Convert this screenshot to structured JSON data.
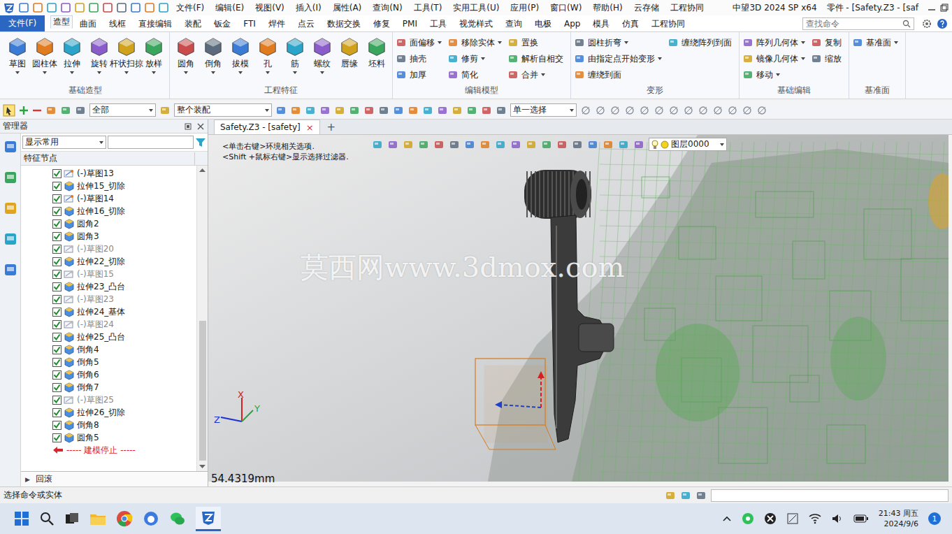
{
  "window": {
    "app": "中望3D 2024 SP x64",
    "title": "零件 - [Safety.Z3 - [saf"
  },
  "menu": [
    "文件(F)",
    "编辑(E)",
    "视图(V)",
    "插入(I)",
    "属性(A)",
    "查询(N)",
    "工具(T)",
    "实用工具(U)",
    "应用(P)",
    "窗口(W)",
    "帮助(H)",
    "云存储",
    "工程协同"
  ],
  "ribbon_tabs": {
    "file_button": "文件(F)",
    "tabs": [
      {
        "label": "造型",
        "selected": true
      },
      {
        "label": "曲面",
        "selected": false
      },
      {
        "label": "线框",
        "selected": false
      },
      {
        "label": "直接编辑",
        "selected": false
      },
      {
        "label": "装配",
        "selected": false
      },
      {
        "label": "钣金",
        "selected": false
      },
      {
        "label": "FTI",
        "selected": false
      },
      {
        "label": "焊件",
        "selected": false
      },
      {
        "label": "点云",
        "selected": false
      },
      {
        "label": "数据交换",
        "selected": false
      },
      {
        "label": "修复",
        "selected": false
      },
      {
        "label": "PMI",
        "selected": false
      },
      {
        "label": "工具",
        "selected": false
      },
      {
        "label": "视觉样式",
        "selected": false
      },
      {
        "label": "查询",
        "selected": false
      },
      {
        "label": "电极",
        "selected": false
      },
      {
        "label": "App",
        "selected": false
      },
      {
        "label": "模具",
        "selected": false
      },
      {
        "label": "仿真",
        "selected": false
      },
      {
        "label": "工程协同",
        "selected": false
      }
    ],
    "search": {
      "placeholder": "查找命令"
    }
  },
  "ribbon_groups": [
    {
      "title": "基础造型",
      "kind": "large",
      "buttons": [
        {
          "label": "草图",
          "dropdown": true
        },
        {
          "label": "圆柱体",
          "dropdown": true
        },
        {
          "label": "拉伸",
          "dropdown": true
        },
        {
          "label": "旋转",
          "dropdown": true
        },
        {
          "label": "杆状扫掠",
          "dropdown": true
        },
        {
          "label": "放样",
          "dropdown": true
        }
      ]
    },
    {
      "title": "工程特征",
      "kind": "large",
      "buttons": [
        {
          "label": "圆角",
          "dropdown": true
        },
        {
          "label": "倒角",
          "dropdown": true
        },
        {
          "label": "拔模",
          "dropdown": true
        },
        {
          "label": "孔",
          "dropdown": true
        },
        {
          "label": "筋",
          "dropdown": true
        },
        {
          "label": "螺纹",
          "dropdown": true
        },
        {
          "label": "唇缘",
          "dropdown": false
        },
        {
          "label": "坯料",
          "dropdown": false
        }
      ]
    },
    {
      "title": "编辑模型",
      "kind": "small",
      "columns": [
        [
          {
            "label": "面偏移",
            "dropdown": true
          },
          {
            "label": "抽壳",
            "dropdown": false
          },
          {
            "label": "加厚",
            "dropdown": false
          }
        ],
        [
          {
            "label": "移除实体",
            "dropdown": true
          },
          {
            "label": "修剪",
            "dropdown": true
          },
          {
            "label": "简化",
            "dropdown": false
          }
        ],
        [
          {
            "label": "置换",
            "dropdown": false
          },
          {
            "label": "解析自相交",
            "dropdown": false
          },
          {
            "label": "合并",
            "dropdown": true
          }
        ]
      ]
    },
    {
      "title": "变形",
      "kind": "small",
      "columns": [
        [
          {
            "label": "圆柱折弯",
            "dropdown": true
          },
          {
            "label": "由指定点开始变形",
            "dropdown": true
          },
          {
            "label": "缠绕到面",
            "dropdown": false
          }
        ],
        [
          {
            "label": "缠绕阵列到面",
            "dropdown": false
          }
        ]
      ]
    },
    {
      "title": "基础编辑",
      "kind": "small",
      "columns": [
        [
          {
            "label": "阵列几何体",
            "dropdown": true
          },
          {
            "label": "镜像几何体",
            "dropdown": true
          },
          {
            "label": "移动",
            "dropdown": true
          }
        ],
        [
          {
            "label": "复制",
            "dropdown": false
          },
          {
            "label": "缩放",
            "dropdown": false
          }
        ]
      ]
    },
    {
      "title": "基准面",
      "kind": "small",
      "columns": [
        [
          {
            "label": "基准面",
            "dropdown": true
          }
        ]
      ]
    }
  ],
  "toolbar": {
    "filter": "全部",
    "scope": "整个装配",
    "select_mode": "单一选择"
  },
  "manager": {
    "title": "管理器",
    "filter": "显示常用",
    "header": "特征节点",
    "items": [
      {
        "label": "(-)草图13",
        "kind": "sketch",
        "checked": true,
        "disabled": false
      },
      {
        "label": "拉伸15_切除",
        "kind": "feature",
        "checked": true,
        "disabled": false
      },
      {
        "label": "(-)草图14",
        "kind": "sketch",
        "checked": true,
        "disabled": false
      },
      {
        "label": "拉伸16_切除",
        "kind": "feature",
        "checked": true,
        "disabled": false
      },
      {
        "label": "圆角2",
        "kind": "feature",
        "checked": true,
        "disabled": false
      },
      {
        "label": "圆角3",
        "kind": "feature",
        "checked": true,
        "disabled": false
      },
      {
        "label": "(-)草图20",
        "kind": "sketch",
        "checked": true,
        "disabled": true
      },
      {
        "label": "拉伸22_切除",
        "kind": "feature",
        "checked": true,
        "disabled": false
      },
      {
        "label": "(-)草图15",
        "kind": "sketch",
        "checked": true,
        "disabled": true
      },
      {
        "label": "拉伸23_凸台",
        "kind": "feature",
        "checked": true,
        "disabled": false
      },
      {
        "label": "(-)草图23",
        "kind": "sketch",
        "checked": true,
        "disabled": true
      },
      {
        "label": "拉伸24_基体",
        "kind": "feature",
        "checked": true,
        "disabled": false
      },
      {
        "label": "(-)草图24",
        "kind": "sketch",
        "checked": true,
        "disabled": true
      },
      {
        "label": "拉伸25_凸台",
        "kind": "feature",
        "checked": true,
        "disabled": false
      },
      {
        "label": "倒角4",
        "kind": "feature",
        "checked": true,
        "disabled": false
      },
      {
        "label": "倒角5",
        "kind": "feature",
        "checked": true,
        "disabled": false
      },
      {
        "label": "倒角6",
        "kind": "feature",
        "checked": true,
        "disabled": false
      },
      {
        "label": "倒角7",
        "kind": "feature",
        "checked": true,
        "disabled": false
      },
      {
        "label": "(-)草图25",
        "kind": "sketch",
        "checked": true,
        "disabled": true
      },
      {
        "label": "拉伸26_切除",
        "kind": "feature",
        "checked": true,
        "disabled": false
      },
      {
        "label": "倒角8",
        "kind": "feature",
        "checked": true,
        "disabled": false
      },
      {
        "label": "圆角5",
        "kind": "feature",
        "checked": true,
        "disabled": false
      }
    ],
    "stop_marker": "----- 建模停止 -----",
    "rollback_toggle": "▶",
    "rollback": "回滚"
  },
  "viewport": {
    "tab": "Safety.Z3 - [safety]",
    "tab_close": "×",
    "tab_add": "+",
    "hints": [
      "<单击右键>环境相关选项.",
      "<Shift +鼠标右键>显示选择过滤器."
    ],
    "layer": "图层0000",
    "watermark": "莫西网www.3dmox.com",
    "measure": "54.4319mm",
    "axes": {
      "x": "X",
      "y": "Y",
      "z": "Z"
    }
  },
  "status_bar": {
    "text": "选择命令或实体"
  },
  "taskbar": {
    "time": "21:43 周五",
    "date": "2024/9/6",
    "badge": "1"
  }
}
